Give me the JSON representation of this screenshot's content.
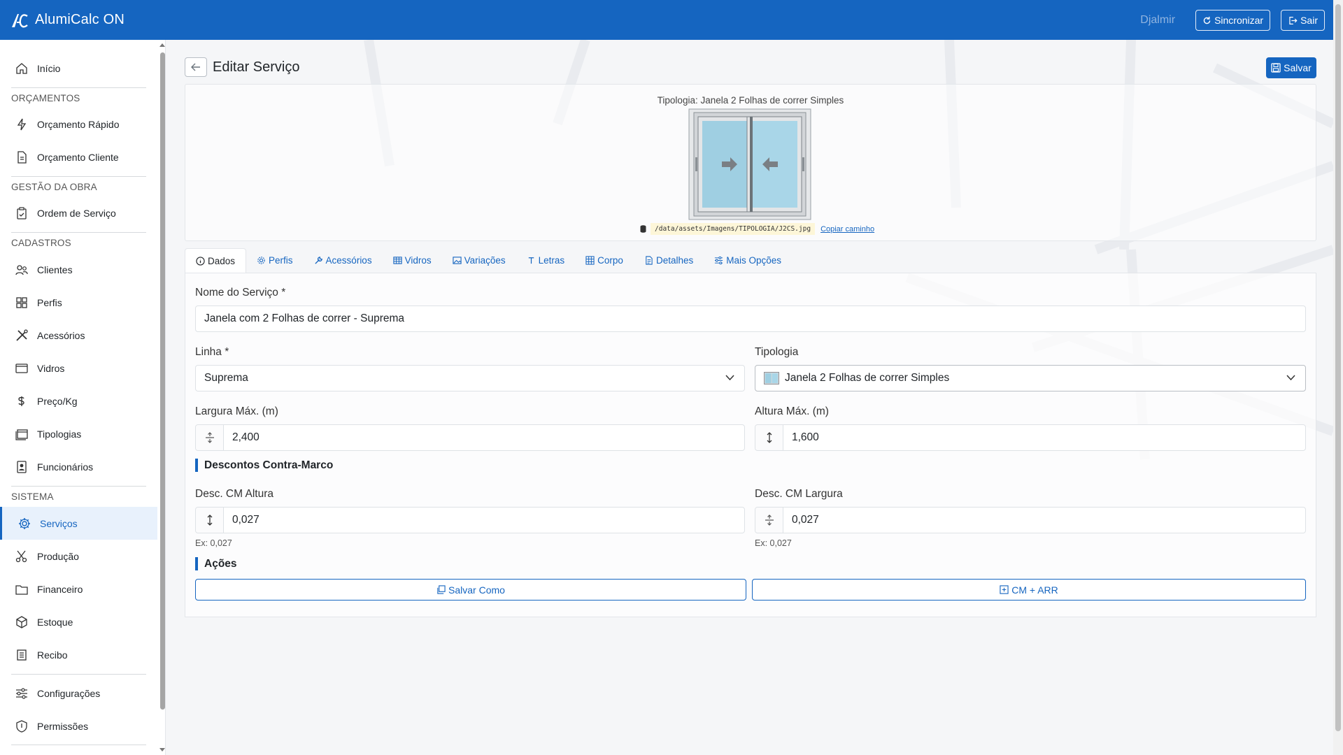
{
  "app": {
    "title": "AlumiCalc ON",
    "brand_color": "#1565c0"
  },
  "topbar": {
    "user": "Djalmir",
    "sync_label": "Sincronizar",
    "exit_label": "Sair"
  },
  "sidebar": {
    "home": "Início",
    "sections": {
      "orcamentos": "ORÇAMENTOS",
      "gestao": "GESTÃO DA OBRA",
      "cadastros": "CADASTROS",
      "sistema": "SISTEMA"
    },
    "items": {
      "orcamento_rapido": "Orçamento Rápido",
      "orcamento_cliente": "Orçamento Cliente",
      "ordem_servico": "Ordem de Serviço",
      "clientes": "Clientes",
      "perfis": "Perfis",
      "acessorios": "Acessórios",
      "vidros": "Vidros",
      "preco_kg": "Preço/Kg",
      "tipologias": "Tipologias",
      "funcionarios": "Funcionários",
      "servicos": "Serviços",
      "producao": "Produção",
      "financeiro": "Financeiro",
      "estoque": "Estoque",
      "recibo": "Recibo",
      "configuracoes": "Configurações",
      "permissoes": "Permissões"
    }
  },
  "page": {
    "title": "Editar Serviço",
    "save_label": "Salvar"
  },
  "preview": {
    "caption": "Tipologia: Janela 2 Folhas de correr Simples",
    "path": "/data/assets/Imagens/TIPOLOGIA/J2CS.jpg",
    "copy_label": "Copiar caminho"
  },
  "tabs": [
    "Dados",
    "Perfis",
    "Acessórios",
    "Vidros",
    "Variações",
    "Letras",
    "Corpo",
    "Detalhes",
    "Mais Opções"
  ],
  "form": {
    "nome_label": "Nome do Serviço *",
    "nome_value": "Janela com 2 Folhas de correr - Suprema",
    "linha_label": "Linha *",
    "linha_value": "Suprema",
    "tipologia_label": "Tipologia",
    "tipologia_value": "Janela 2 Folhas de correr Simples",
    "largura_label": "Largura Máx. (m)",
    "largura_value": "2,400",
    "altura_label": "Altura Máx. (m)",
    "altura_value": "1,600",
    "descontos_title": "Descontos Contra-Marco",
    "desc_altura_label": "Desc. CM Altura",
    "desc_altura_value": "0,027",
    "desc_altura_hint": "Ex: 0,027",
    "desc_largura_label": "Desc. CM Largura",
    "desc_largura_value": "0,027",
    "desc_largura_hint": "Ex: 0,027",
    "acoes_title": "Ações",
    "salvar_como": "Salvar Como",
    "cm_arr": "CM + ARR"
  }
}
